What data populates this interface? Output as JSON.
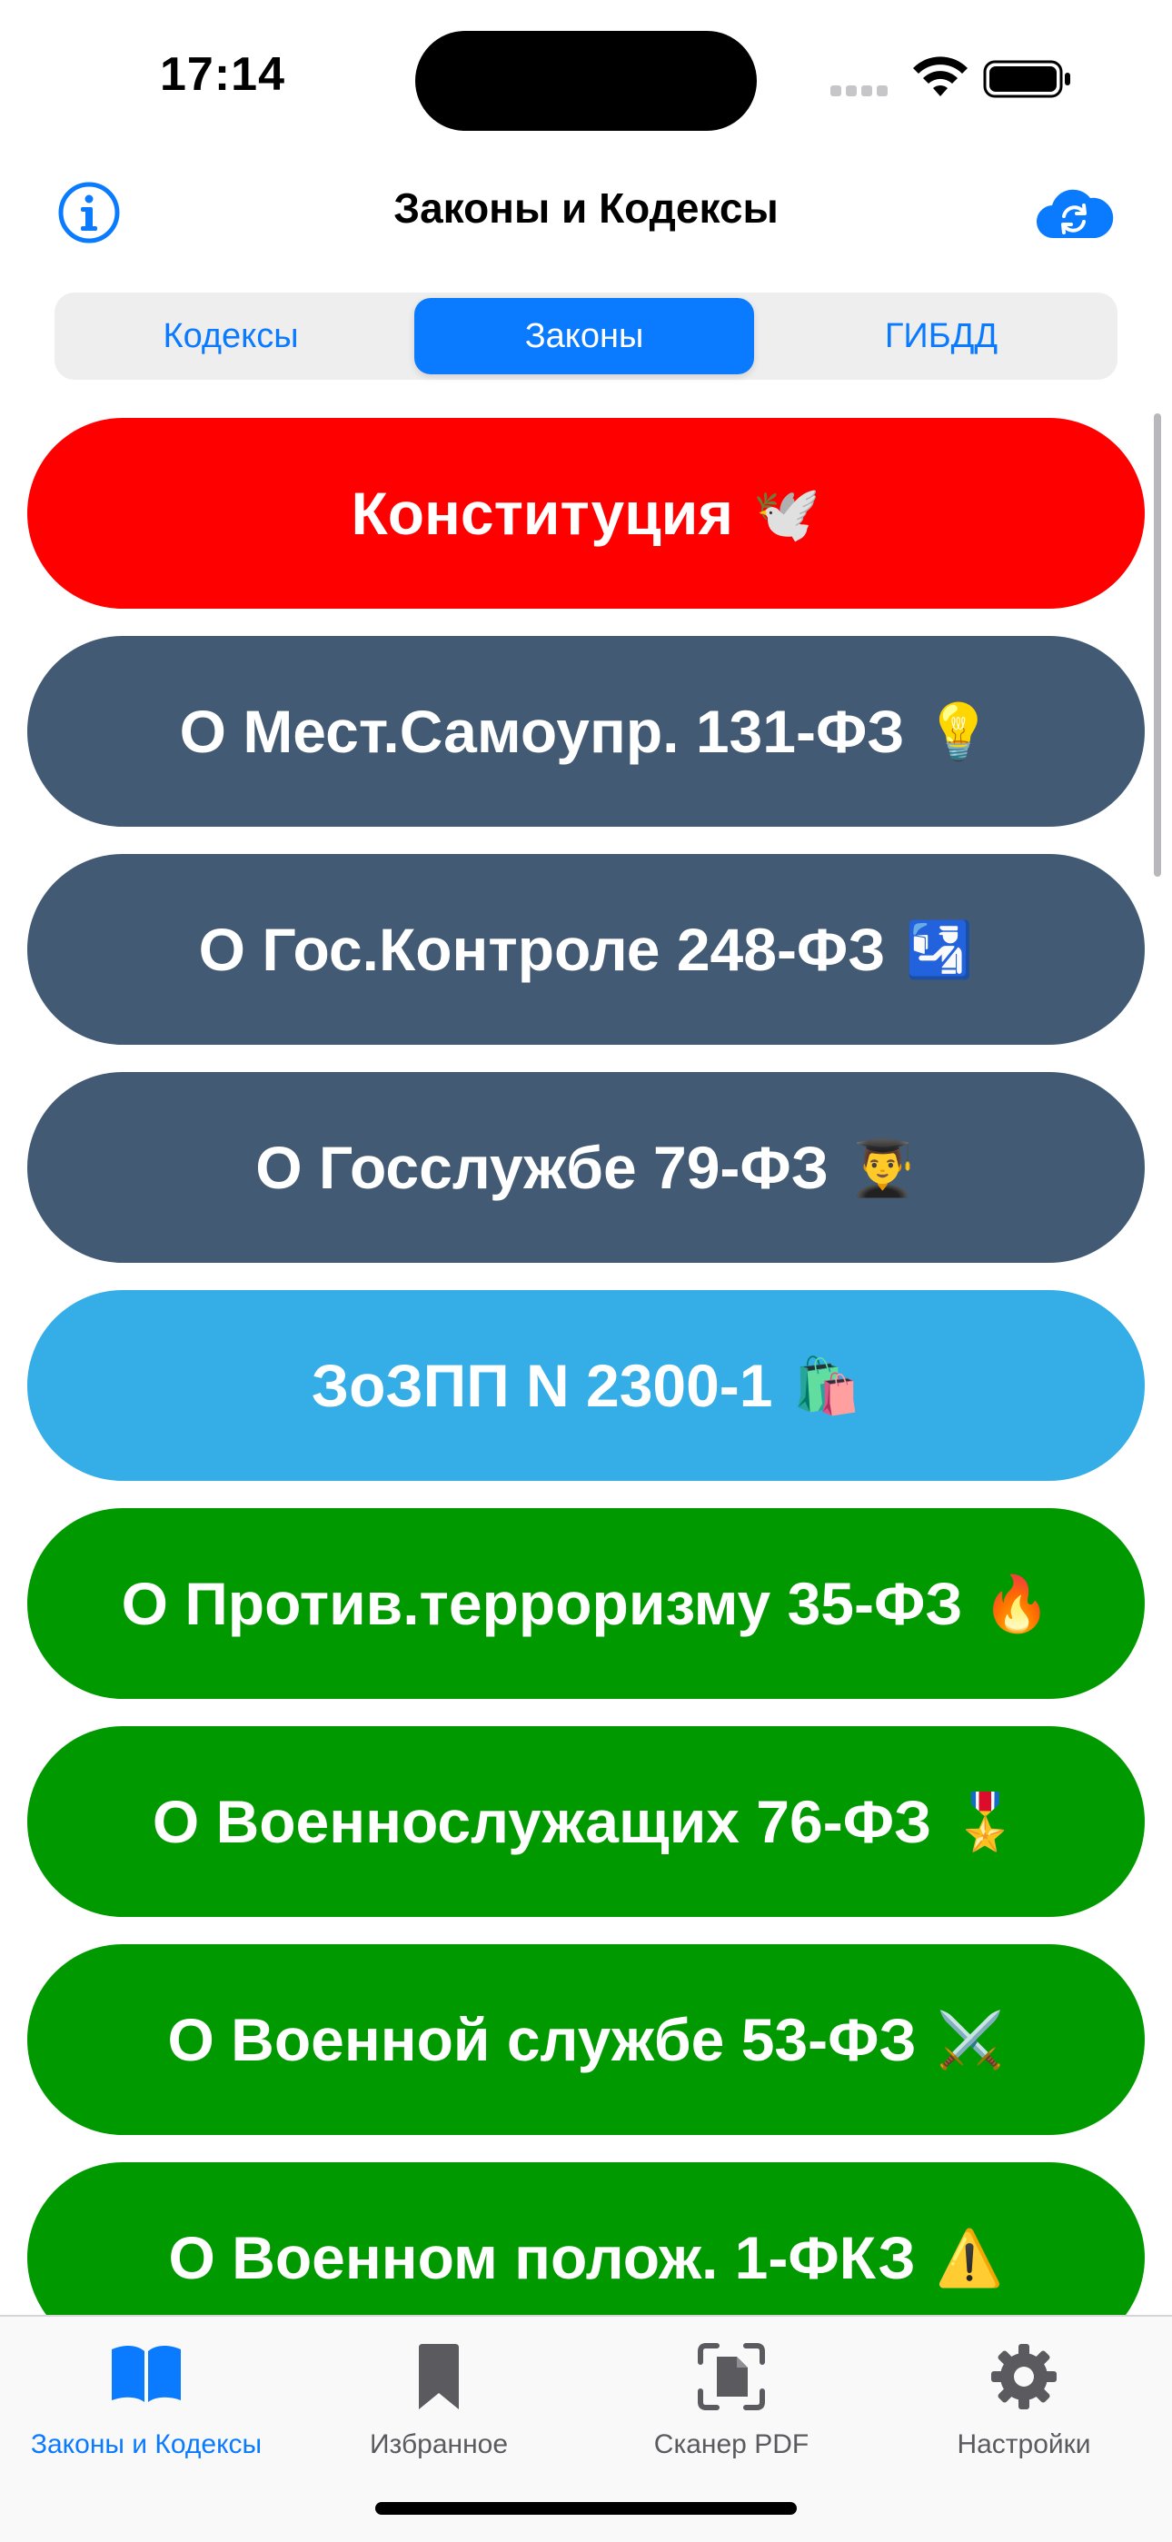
{
  "status_bar": {
    "time": "17:14"
  },
  "nav": {
    "title": "Законы и Кодексы",
    "info_icon": "info-circle-icon",
    "cloud_icon": "cloud-sync-icon"
  },
  "segments": [
    {
      "label": "Кодексы",
      "selected": false
    },
    {
      "label": "Законы",
      "selected": true
    },
    {
      "label": "ГИБДД",
      "selected": false
    }
  ],
  "laws": [
    {
      "label": "Конституция",
      "emoji": "🕊️",
      "color": "#ff0000"
    },
    {
      "label": "О Мест.Самоупр. 131-ФЗ",
      "emoji": "💡",
      "color": "#425a73"
    },
    {
      "label": "О Гос.Контроле 248-ФЗ",
      "emoji": "🛂",
      "color": "#425a73"
    },
    {
      "label": "О Госслужбе 79-ФЗ",
      "emoji": "👨‍🎓",
      "color": "#425a73"
    },
    {
      "label": "ЗоЗПП N 2300-1",
      "emoji": "🛍️",
      "color": "#35ade6"
    },
    {
      "label": "О Против.терроризму 35-ФЗ",
      "emoji": "🔥",
      "color": "#009a00"
    },
    {
      "label": "О Военнослужащих 76-ФЗ",
      "emoji": "🎖️",
      "color": "#009a00"
    },
    {
      "label": "О Военной службе 53-ФЗ",
      "emoji": "⚔️",
      "color": "#009a00"
    },
    {
      "label": "О Военном полож. 1-ФКЗ",
      "emoji": "⚠️",
      "color": "#009a00"
    }
  ],
  "tab_bar": [
    {
      "label": "Законы и Кодексы",
      "icon": "open-book-icon",
      "active": true
    },
    {
      "label": "Избранное",
      "icon": "bookmark-icon",
      "active": false
    },
    {
      "label": "Сканер PDF",
      "icon": "document-scanner-icon",
      "active": false
    },
    {
      "label": "Настройки",
      "icon": "gear-icon",
      "active": false
    }
  ],
  "colors": {
    "accent": "#0a7aff",
    "inactive_tab": "#5a5a5f"
  }
}
